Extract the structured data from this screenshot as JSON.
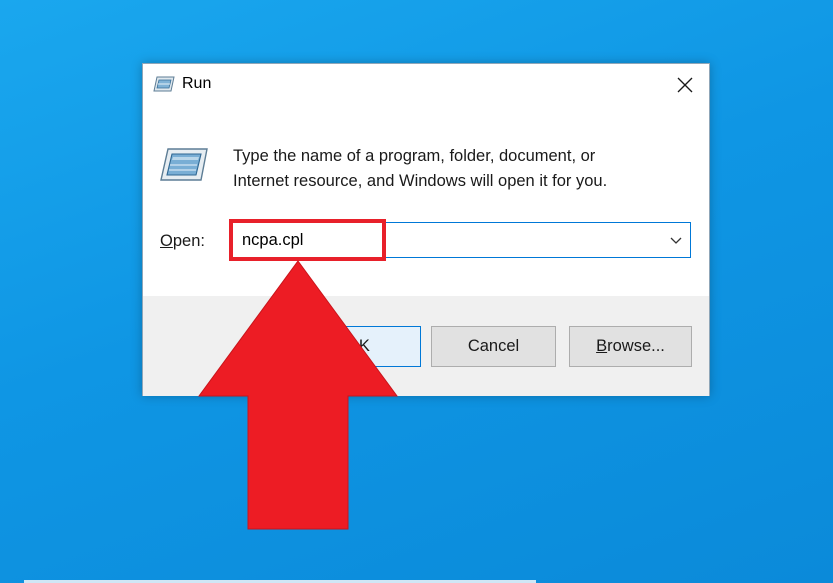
{
  "dialog": {
    "title": "Run",
    "instruction_line1": "Type the name of a program, folder, document, or",
    "instruction_line2": "Internet resource, and Windows will open it for you.",
    "open_label_accel": "O",
    "open_label_rest": "pen:",
    "open_value": "ncpa.cpl",
    "buttons": {
      "ok_label": "OK",
      "cancel_label": "Cancel",
      "browse_accel": "B",
      "browse_rest": "rowse..."
    }
  },
  "icons": {
    "title": "run-app-icon",
    "body": "run-app-icon",
    "close": "close-icon",
    "dropdown": "chevron-down-icon"
  },
  "colors": {
    "desktop": "#1aa7ee",
    "accent": "#0078d7",
    "annotation": "#e8202a",
    "button_bg": "#e1e1e1",
    "button_area": "#f0f0f0"
  }
}
